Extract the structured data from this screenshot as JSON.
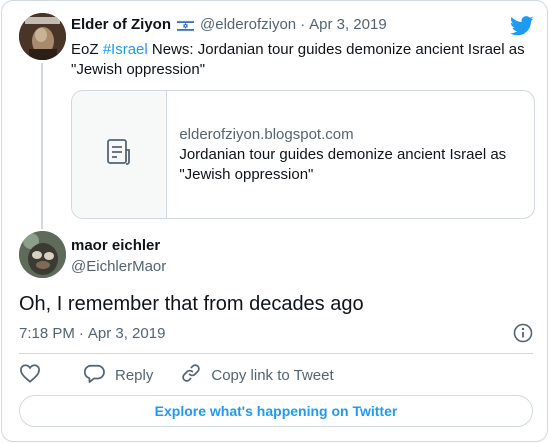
{
  "parent_tweet": {
    "author_name": "Elder of Ziyon",
    "flag_icon": "israel-flag-icon",
    "handle": "@elderofziyon",
    "separator": "·",
    "date": "Apr 3, 2019",
    "text_prefix": "EoZ ",
    "hashtag": "#Israel",
    "text_suffix": " News: Jordanian tour guides demonize ancient Israel as \"Jewish oppression\"",
    "link_card": {
      "domain": "elderofziyon.blogspot.com",
      "title": "Jordanian tour guides demonize ancient Israel as \"Jewish oppression\""
    }
  },
  "reply_tweet": {
    "author_name": "maor eichler",
    "handle": "@EichlerMaor",
    "text": "Oh, I remember that from decades ago",
    "time": "7:18 PM",
    "separator": "·",
    "date": "Apr 3, 2019"
  },
  "actions": {
    "reply_label": "Reply",
    "copy_link_label": "Copy link to Tweet"
  },
  "explore_button_label": "Explore what's happening on Twitter",
  "colors": {
    "accent": "#1d9bf0",
    "secondary_text": "#536471",
    "border": "#cfd9de"
  }
}
